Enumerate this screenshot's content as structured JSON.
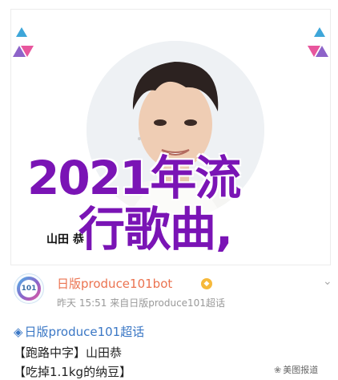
{
  "photo": {
    "name_tag": "山田 恭",
    "overlay_line_1": "2021年流",
    "overlay_line_2": "行歌曲,"
  },
  "post": {
    "avatar_text": "PRODUCE 101",
    "author": "日版produce101bot",
    "verified_icon": "verified-badge-icon",
    "verified_glyph": "◆",
    "menu_glyph": "⌄",
    "meta": "昨天 15:51  来自日版produce101超话",
    "super_topic_icon_glyph": "◈",
    "super_topic": "日版produce101超话",
    "line_1": "【跑路中字】山田恭",
    "line_2": "【吃掉1.1kg的纳豆】",
    "watermark": "美图报道",
    "watermark_icon_glyph": "❀"
  },
  "colors": {
    "author": "#eb7350",
    "topic": "#3a77c5",
    "overlay": "#7a14b5"
  }
}
